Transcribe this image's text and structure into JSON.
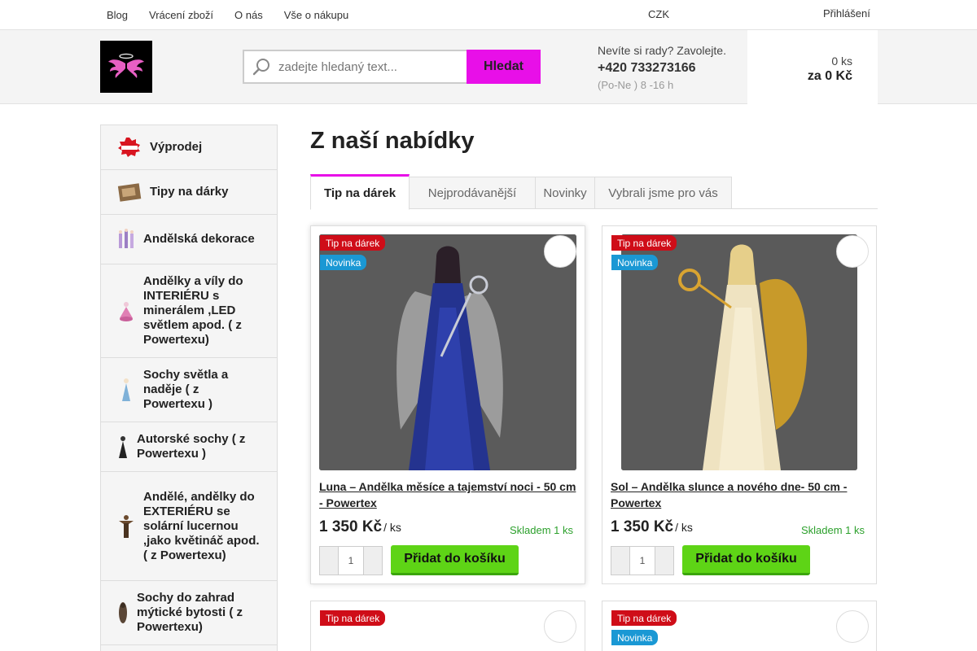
{
  "topbar": {
    "links": [
      "Blog",
      "Vrácení zboží",
      "O nás",
      "Vše o nákupu"
    ],
    "currency": "CZK",
    "login": "Přihlášení"
  },
  "header": {
    "search_placeholder": "zadejte hledaný text...",
    "search_button": "Hledat",
    "contact_question": "Nevíte si rady? Zavolejte.",
    "phone": "+420 733273166",
    "hours": "(Po-Ne ) 8 -16 h",
    "cart_count": "0 ks",
    "cart_total": "za 0 Kč"
  },
  "sidebar": {
    "items": [
      {
        "label": "Výprodej",
        "icon": "sale-badge-icon"
      },
      {
        "label": "Tipy na dárky",
        "icon": "gift-box-icon"
      },
      {
        "label": "Andělská dekorace",
        "icon": "angel-decor-icon"
      },
      {
        "label": "Andělky a víly do INTERIÉRU s minerálem ,LED světlem apod. ( z Powertexu)",
        "icon": "fairy-figure-icon"
      },
      {
        "label": "Sochy světla a naděje ( z Powertexu )",
        "icon": "statue-light-icon"
      },
      {
        "label": "Autorské sochy ( z Powertexu )",
        "icon": "author-statue-icon"
      },
      {
        "label": "Andělé, andělky do EXTERIÉRU se solární lucernou ,jako květináč apod. ( z Powertexu)",
        "icon": "garden-angel-icon"
      },
      {
        "label": "Sochy do zahrad mýtické bytosti ( z Powertexu)",
        "icon": "mythic-statue-icon"
      }
    ]
  },
  "main": {
    "title": "Z naší nabídky",
    "tabs": [
      "Tip na dárek",
      "Nejprodávanější",
      "Novinky",
      "Vybrali jsme pro vás"
    ],
    "active_tab": "Tip na dárek",
    "products": [
      {
        "name": "Luna – Andělka měsíce a tajemství noci - 50 cm - Powertex",
        "price": "1 350 Kč",
        "unit": "/ ks",
        "stock": "Skladem 1 ks",
        "qty": "1",
        "add": "Přidat do košíku",
        "flags": [
          "Tip na dárek",
          "Novinka"
        ],
        "image": "blue-angel-statue"
      },
      {
        "name": "Sol – Andělka slunce a nového dne- 50 cm - Powertex",
        "price": "1 350 Kč",
        "unit": "/ ks",
        "stock": "Skladem 1 ks",
        "qty": "1",
        "add": "Přidat do košíku",
        "flags": [
          "Tip na dárek",
          "Novinka"
        ],
        "image": "gold-angel-statue"
      },
      {
        "flags": [
          "Tip na dárek"
        ]
      },
      {
        "flags": [
          "Tip na dárek",
          "Novinka"
        ]
      }
    ]
  },
  "colors": {
    "accent": "#e80fe8",
    "add_button": "#5ed416",
    "flag_tip": "#cf0d18",
    "flag_new": "#1a98d4",
    "stock": "#2ca02c"
  }
}
